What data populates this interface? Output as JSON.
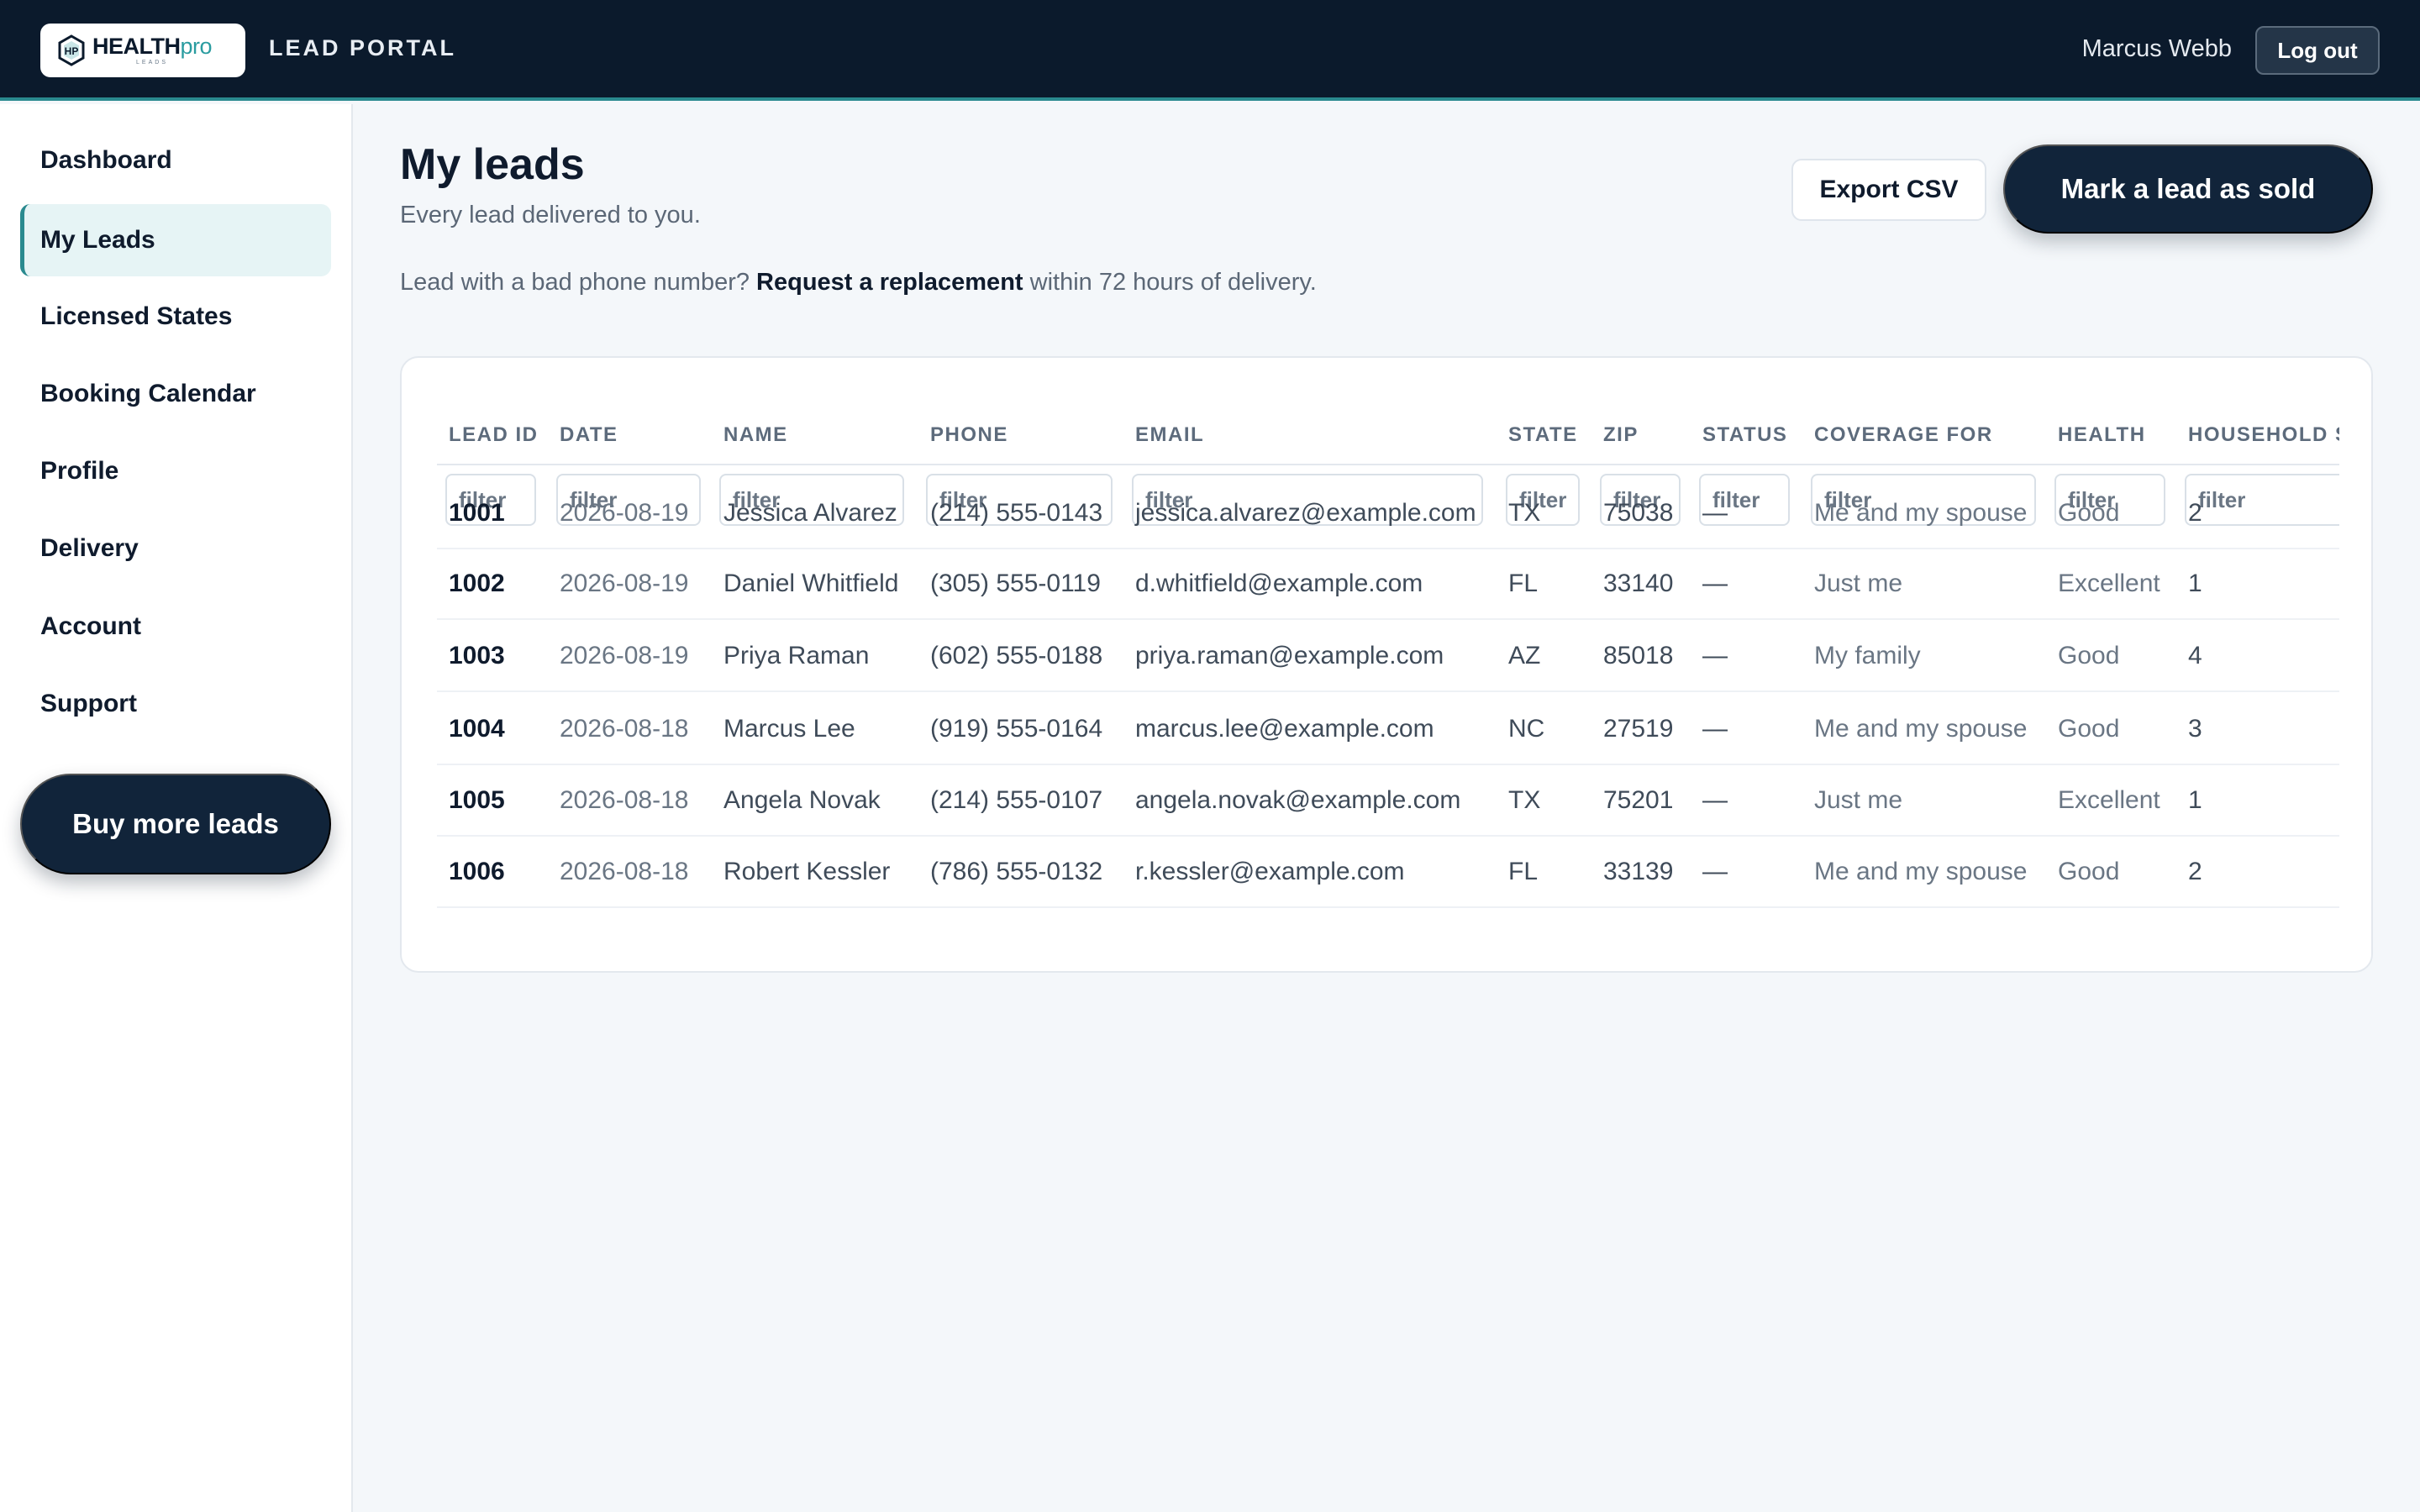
{
  "header": {
    "logo_health": "HEALTH",
    "logo_pro": "pro",
    "logo_sub": "LEADS",
    "portal_title": "LEAD PORTAL",
    "user_name": "Marcus Webb",
    "logout_label": "Log out"
  },
  "sidebar": {
    "items": [
      {
        "label": "Dashboard"
      },
      {
        "label": "My Leads"
      },
      {
        "label": "Licensed States"
      },
      {
        "label": "Booking Calendar"
      },
      {
        "label": "Profile"
      },
      {
        "label": "Delivery"
      },
      {
        "label": "Account"
      },
      {
        "label": "Support"
      }
    ],
    "active_item": "My Leads",
    "buy_button": "Buy more leads"
  },
  "main": {
    "title": "My leads",
    "subtitle": "Every lead delivered to you.",
    "notice_prefix": "Lead with a bad phone number?",
    "notice_link": "Request a replacement",
    "notice_suffix": "within 72 hours of delivery.",
    "export_label": "Export CSV",
    "sold_label": "Mark a lead as sold"
  },
  "table": {
    "columns": [
      "LEAD ID",
      "DATE",
      "NAME",
      "PHONE",
      "EMAIL",
      "STATE",
      "ZIP",
      "STATUS",
      "COVERAGE FOR",
      "HEALTH",
      "HOUSEHOLD SIZE"
    ],
    "filter_placeholder": "filter",
    "rows": [
      [
        "1001",
        "2026-08-19",
        "Jessica Alvarez",
        "(214) 555-0143",
        "jessica.alvarez@example.com",
        "TX",
        "75038",
        "—",
        "Me and my spouse",
        "Good",
        "2"
      ],
      [
        "1002",
        "2026-08-19",
        "Daniel Whitfield",
        "(305) 555-0119",
        "d.whitfield@example.com",
        "FL",
        "33140",
        "—",
        "Just me",
        "Excellent",
        "1"
      ],
      [
        "1003",
        "2026-08-19",
        "Priya Raman",
        "(602) 555-0188",
        "priya.raman@example.com",
        "AZ",
        "85018",
        "—",
        "My family",
        "Good",
        "4"
      ],
      [
        "1004",
        "2026-08-18",
        "Marcus Lee",
        "(919) 555-0164",
        "marcus.lee@example.com",
        "NC",
        "27519",
        "—",
        "Me and my spouse",
        "Good",
        "3"
      ],
      [
        "1005",
        "2026-08-18",
        "Angela Novak",
        "(214) 555-0107",
        "angela.novak@example.com",
        "TX",
        "75201",
        "—",
        "Just me",
        "Excellent",
        "1"
      ],
      [
        "1006",
        "2026-08-18",
        "Robert Kessler",
        "(786) 555-0132",
        "r.kessler@example.com",
        "FL",
        "33139",
        "—",
        "Me and my spouse",
        "Good",
        "2"
      ]
    ]
  },
  "colors": {
    "topbar": "#0b1a2c",
    "accent_teal": "#2a8a8f",
    "primary_button": "#11243a",
    "active_nav_bg": "#e6f4f5"
  }
}
